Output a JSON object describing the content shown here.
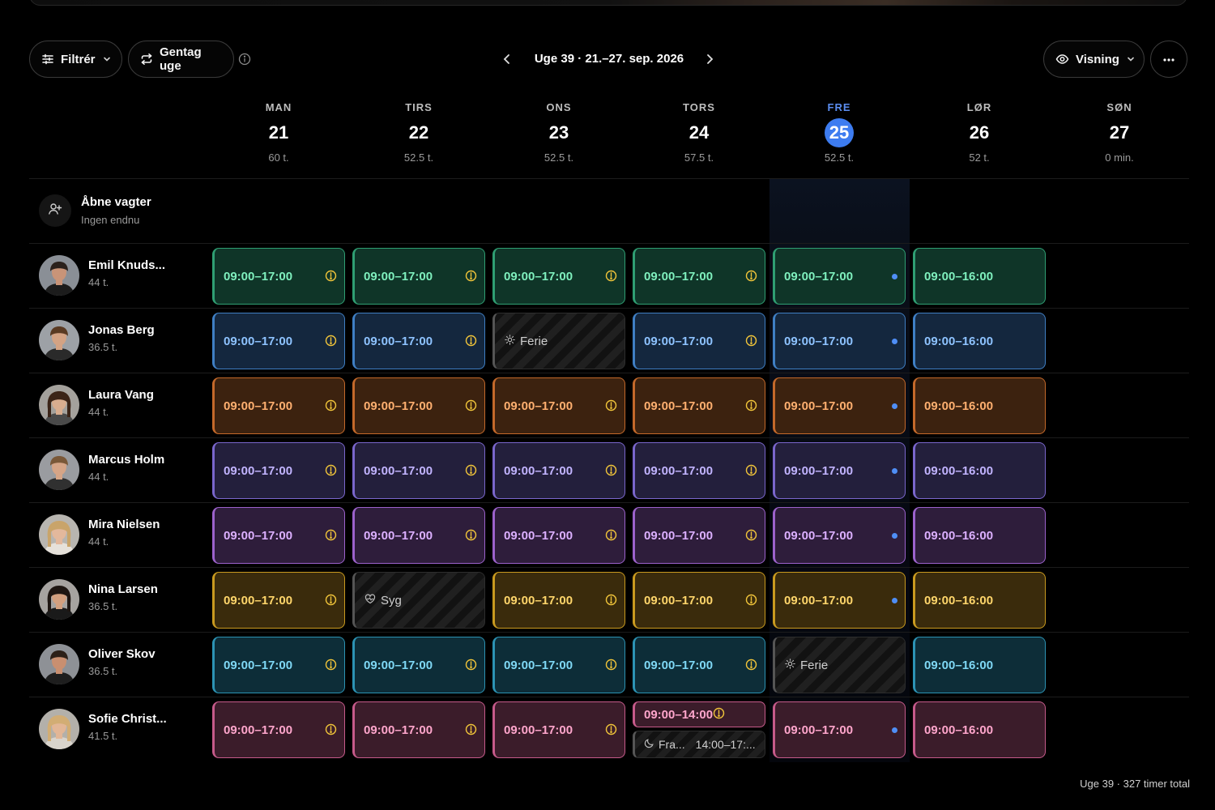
{
  "toolbar": {
    "filter_label": "Filtrér",
    "repeat_label": "Gentag uge",
    "week_label": "Uge 39 · 21.–27. sep. 2026",
    "view_label": "Visning"
  },
  "days": [
    {
      "name": "MAN",
      "num": "21",
      "hours": "60 t."
    },
    {
      "name": "TIRS",
      "num": "22",
      "hours": "52.5 t."
    },
    {
      "name": "ONS",
      "num": "23",
      "hours": "52.5 t."
    },
    {
      "name": "TORS",
      "num": "24",
      "hours": "57.5 t."
    },
    {
      "name": "FRE",
      "num": "25",
      "hours": "52.5 t."
    },
    {
      "name": "LØR",
      "num": "26",
      "hours": "52 t."
    },
    {
      "name": "SØN",
      "num": "27",
      "hours": "0 min."
    }
  ],
  "today_index": 4,
  "open_shifts": {
    "title": "Åbne vagter",
    "subtitle": "Ingen endnu"
  },
  "employees": [
    {
      "name": "Emil Knuds...",
      "hours": "44 t.",
      "theme": "green",
      "shifts": [
        {
          "type": "shift",
          "time": "09:00–17:00",
          "marker": "warn"
        },
        {
          "type": "shift",
          "time": "09:00–17:00",
          "marker": "warn"
        },
        {
          "type": "shift",
          "time": "09:00–17:00",
          "marker": "warn"
        },
        {
          "type": "shift",
          "time": "09:00–17:00",
          "marker": "warn"
        },
        {
          "type": "shift",
          "time": "09:00–17:00",
          "marker": "dot"
        },
        {
          "type": "shift",
          "time": "09:00–16:00",
          "marker": "none"
        }
      ]
    },
    {
      "name": "Jonas Berg",
      "hours": "36.5 t.",
      "theme": "blue",
      "shifts": [
        {
          "type": "shift",
          "time": "09:00–17:00",
          "marker": "warn"
        },
        {
          "type": "shift",
          "time": "09:00–17:00",
          "marker": "warn"
        },
        {
          "type": "absence",
          "label": "Ferie",
          "icon": "sun-icon"
        },
        {
          "type": "shift",
          "time": "09:00–17:00",
          "marker": "warn"
        },
        {
          "type": "shift",
          "time": "09:00–17:00",
          "marker": "dot"
        },
        {
          "type": "shift",
          "time": "09:00–16:00",
          "marker": "none"
        }
      ]
    },
    {
      "name": "Laura Vang",
      "hours": "44 t.",
      "theme": "orange",
      "shifts": [
        {
          "type": "shift",
          "time": "09:00–17:00",
          "marker": "warn"
        },
        {
          "type": "shift",
          "time": "09:00–17:00",
          "marker": "warn"
        },
        {
          "type": "shift",
          "time": "09:00–17:00",
          "marker": "warn"
        },
        {
          "type": "shift",
          "time": "09:00–17:00",
          "marker": "warn"
        },
        {
          "type": "shift",
          "time": "09:00–17:00",
          "marker": "dot"
        },
        {
          "type": "shift",
          "time": "09:00–16:00",
          "marker": "none"
        }
      ]
    },
    {
      "name": "Marcus Holm",
      "hours": "44 t.",
      "theme": "indigo",
      "shifts": [
        {
          "type": "shift",
          "time": "09:00–17:00",
          "marker": "warn"
        },
        {
          "type": "shift",
          "time": "09:00–17:00",
          "marker": "warn"
        },
        {
          "type": "shift",
          "time": "09:00–17:00",
          "marker": "warn"
        },
        {
          "type": "shift",
          "time": "09:00–17:00",
          "marker": "warn"
        },
        {
          "type": "shift",
          "time": "09:00–17:00",
          "marker": "dot"
        },
        {
          "type": "shift",
          "time": "09:00–16:00",
          "marker": "none"
        }
      ]
    },
    {
      "name": "Mira Nielsen",
      "hours": "44 t.",
      "theme": "purple",
      "shifts": [
        {
          "type": "shift",
          "time": "09:00–17:00",
          "marker": "warn"
        },
        {
          "type": "shift",
          "time": "09:00–17:00",
          "marker": "warn"
        },
        {
          "type": "shift",
          "time": "09:00–17:00",
          "marker": "warn"
        },
        {
          "type": "shift",
          "time": "09:00–17:00",
          "marker": "warn"
        },
        {
          "type": "shift",
          "time": "09:00–17:00",
          "marker": "dot"
        },
        {
          "type": "shift",
          "time": "09:00–16:00",
          "marker": "none"
        }
      ]
    },
    {
      "name": "Nina Larsen",
      "hours": "36.5 t.",
      "theme": "yellow",
      "shifts": [
        {
          "type": "shift",
          "time": "09:00–17:00",
          "marker": "warn"
        },
        {
          "type": "absence",
          "label": "Syg",
          "icon": "heart-icon"
        },
        {
          "type": "shift",
          "time": "09:00–17:00",
          "marker": "warn"
        },
        {
          "type": "shift",
          "time": "09:00–17:00",
          "marker": "warn"
        },
        {
          "type": "shift",
          "time": "09:00–17:00",
          "marker": "dot"
        },
        {
          "type": "shift",
          "time": "09:00–16:00",
          "marker": "none"
        }
      ]
    },
    {
      "name": "Oliver Skov",
      "hours": "36.5 t.",
      "theme": "cyan",
      "shifts": [
        {
          "type": "shift",
          "time": "09:00–17:00",
          "marker": "warn"
        },
        {
          "type": "shift",
          "time": "09:00–17:00",
          "marker": "warn"
        },
        {
          "type": "shift",
          "time": "09:00–17:00",
          "marker": "warn"
        },
        {
          "type": "shift",
          "time": "09:00–17:00",
          "marker": "warn"
        },
        {
          "type": "absence",
          "label": "Ferie",
          "icon": "sun-icon"
        },
        {
          "type": "shift",
          "time": "09:00–16:00",
          "marker": "none"
        }
      ]
    },
    {
      "name": "Sofie Christ...",
      "hours": "41.5 t.",
      "theme": "pink",
      "shifts": [
        {
          "type": "shift",
          "time": "09:00–17:00",
          "marker": "warn"
        },
        {
          "type": "shift",
          "time": "09:00–17:00",
          "marker": "warn"
        },
        {
          "type": "shift",
          "time": "09:00–17:00",
          "marker": "warn"
        },
        {
          "type": "split",
          "time": "09:00–14:00",
          "marker": "warn",
          "absence_label": "Fra...",
          "absence_time": "14:00–17:...",
          "icon": "moon-icon"
        },
        {
          "type": "shift",
          "time": "09:00–17:00",
          "marker": "dot"
        },
        {
          "type": "shift",
          "time": "09:00–16:00",
          "marker": "none"
        }
      ]
    }
  ],
  "themes": {
    "green": {
      "bg": "#0f3528",
      "border": "#2f9f73",
      "text": "#7ff0be"
    },
    "blue": {
      "bg": "#14273e",
      "border": "#3f7fc4",
      "text": "#8ec3ff"
    },
    "orange": {
      "bg": "#3c220f",
      "border": "#c4692a",
      "text": "#ffb070"
    },
    "indigo": {
      "bg": "#231f3c",
      "border": "#7a66cc",
      "text": "#c2b4ff"
    },
    "purple": {
      "bg": "#2e1d3b",
      "border": "#9c62cc",
      "text": "#dcb0ff"
    },
    "yellow": {
      "bg": "#3a2b0c",
      "border": "#c99a1f",
      "text": "#ffd66b"
    },
    "cyan": {
      "bg": "#0d2d38",
      "border": "#2c93b4",
      "text": "#7fd8f5"
    },
    "pink": {
      "bg": "#3b1c2a",
      "border": "#c65a8a",
      "text": "#ffa6cc"
    }
  },
  "today_dot_color": "#4f8ef5",
  "warn_color": "#f0c43a",
  "footer": "Uge 39 · 327 timer total"
}
